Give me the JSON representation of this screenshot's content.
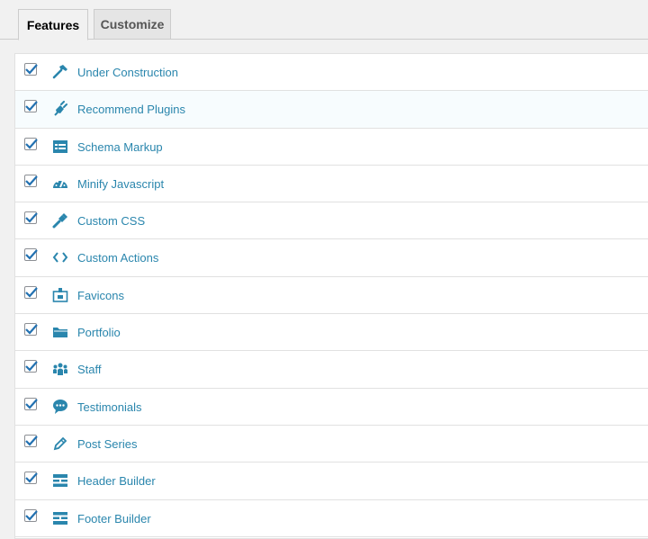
{
  "tabs": [
    {
      "label": "Features"
    },
    {
      "label": "Customize"
    }
  ],
  "colors": {
    "accent": "#2a86ad",
    "checkmark": "#2271b1"
  },
  "features": [
    {
      "label": "Under Construction",
      "icon": "hammer-icon",
      "checked": true
    },
    {
      "label": "Recommend Plugins",
      "icon": "plugin-icon",
      "checked": true
    },
    {
      "label": "Schema Markup",
      "icon": "schema-icon",
      "checked": true
    },
    {
      "label": "Minify Javascript",
      "icon": "dashboard-icon",
      "checked": true
    },
    {
      "label": "Custom CSS",
      "icon": "customizer-brush-icon",
      "checked": true
    },
    {
      "label": "Custom Actions",
      "icon": "code-icon",
      "checked": true
    },
    {
      "label": "Favicons",
      "icon": "id-badge-icon",
      "checked": true
    },
    {
      "label": "Portfolio",
      "icon": "folder-icon",
      "checked": true
    },
    {
      "label": "Staff",
      "icon": "groups-icon",
      "checked": true
    },
    {
      "label": "Testimonials",
      "icon": "speech-bubble-icon",
      "checked": true
    },
    {
      "label": "Post Series",
      "icon": "pencil-icon",
      "checked": true
    },
    {
      "label": "Header Builder",
      "icon": "header-layout-icon",
      "checked": true
    },
    {
      "label": "Footer Builder",
      "icon": "footer-layout-icon",
      "checked": true
    }
  ]
}
